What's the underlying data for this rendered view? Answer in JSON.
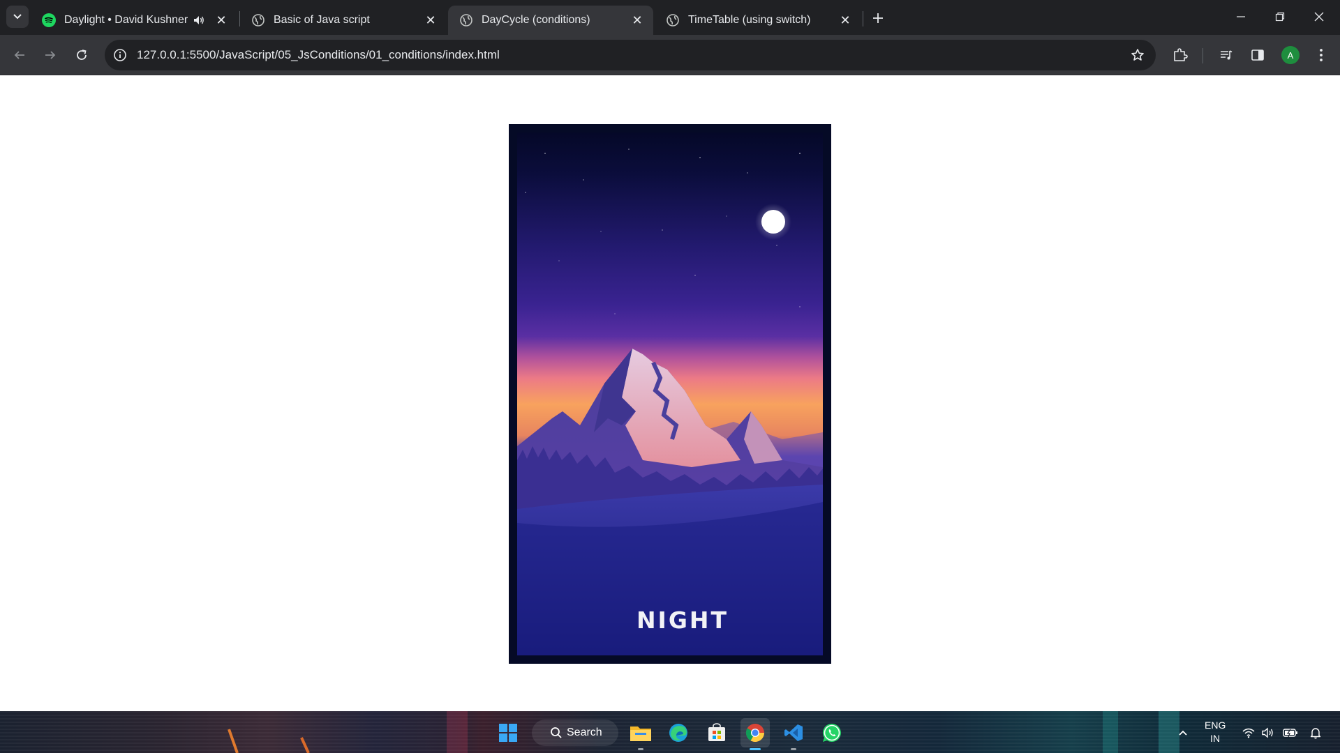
{
  "browser": {
    "tabs": [
      {
        "title": "Daylight • David Kushner",
        "icon": "spotify-icon",
        "playing_audio": true,
        "active": false
      },
      {
        "title": "Basic of Java script",
        "icon": "globe-icon",
        "active": false
      },
      {
        "title": "DayCycle (conditions)",
        "icon": "globe-icon",
        "active": true
      },
      {
        "title": "TimeTable (using switch)",
        "icon": "globe-icon",
        "active": false
      }
    ],
    "address_bar": {
      "url": "127.0.0.1:5500/JavaScript/05_JsConditions/01_conditions/index.html"
    },
    "profile_initial": "A"
  },
  "page": {
    "card_label": "NIGHT",
    "colors": {
      "frame": "#050a26",
      "sky_top": "#070a2a",
      "sky_mid": "#4a2a9a",
      "horizon": "#f8a65a",
      "ground": "#1c1f86",
      "moon": "#ffffff"
    }
  },
  "taskbar": {
    "search_label": "Search",
    "apps": [
      "windows-start-icon",
      "file-explorer-icon",
      "edge-icon",
      "store-icon",
      "chrome-icon",
      "vscode-icon",
      "whatsapp-icon"
    ],
    "tray": {
      "language_line1": "ENG",
      "language_line2": "IN"
    }
  }
}
